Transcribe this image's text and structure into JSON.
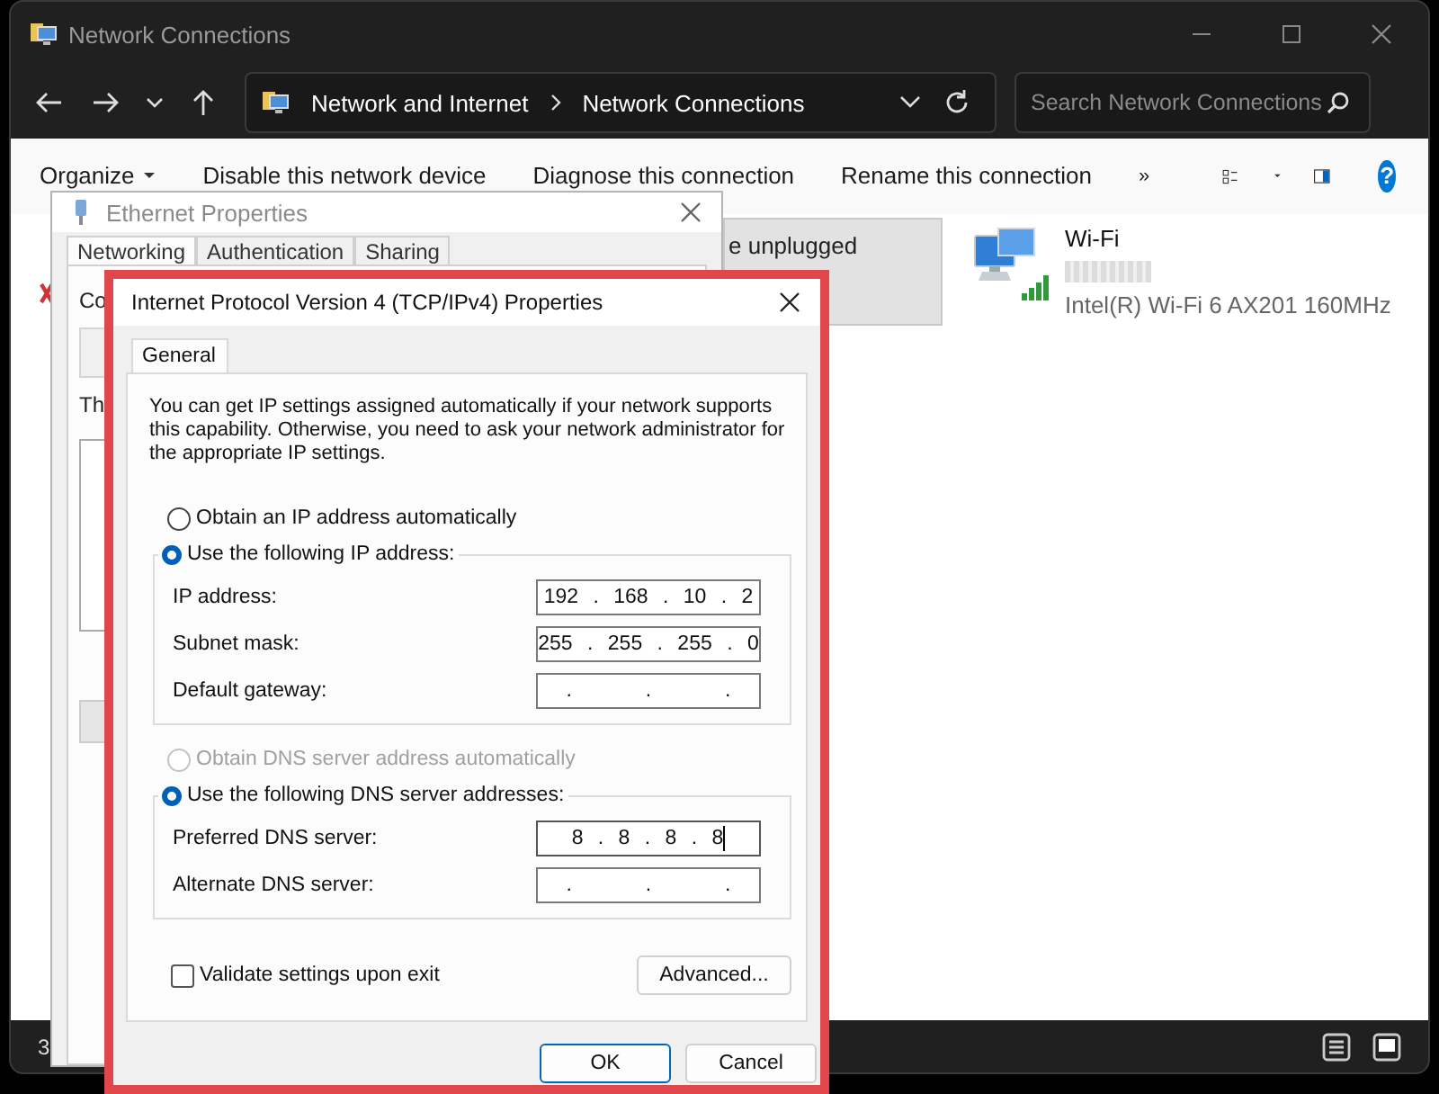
{
  "explorer": {
    "title": "Network Connections",
    "breadcrumb": [
      "Network and Internet",
      "Network Connections"
    ],
    "search": {
      "placeholder": "Search Network Connections"
    },
    "commands": [
      {
        "label": "Organize",
        "kind": "menu"
      },
      {
        "label": "Disable this network device",
        "kind": "action"
      },
      {
        "label": "Diagnose this connection",
        "kind": "action"
      },
      {
        "label": "Rename this connection",
        "kind": "action"
      }
    ],
    "overflow": "»",
    "help": "?",
    "connections": [
      {
        "kind": "partial",
        "status": "e unplugged",
        "selected": true
      },
      {
        "kind": "wifi",
        "name": "Wi-Fi",
        "adapter": "Intel(R) Wi-Fi 6 AX201 160MHz",
        "selected": false
      }
    ],
    "status_bar": {
      "item_count": "3"
    }
  },
  "ethernet_properties": {
    "title": "Ethernet Properties",
    "tabs": [
      {
        "label": "Networking",
        "selected": true
      },
      {
        "label": "Authentication",
        "selected": false
      },
      {
        "label": "Sharing",
        "selected": false
      }
    ],
    "labels": [
      "Co",
      "Th"
    ]
  },
  "ipv4_dialog": {
    "title": "Internet Protocol Version 4 (TCP/IPv4) Properties",
    "highlighted": true,
    "tabs": [
      {
        "label": "General",
        "selected": true
      }
    ],
    "description": "You can get IP settings assigned automatically if your network supports this capability. Otherwise, you need to ask your network administrator for the appropriate IP settings.",
    "sections": [
      {
        "auto_option": {
          "label": "Obtain an IP address automatically",
          "selected": false,
          "disabled": false
        },
        "manual_option": {
          "label": "Use the following IP address:",
          "selected": true,
          "disabled": false
        },
        "fields": [
          {
            "label": "IP address:",
            "value": "192 . 168 . 10 . 2",
            "focused": false
          },
          {
            "label": "Subnet mask:",
            "value": "255 . 255 . 255 . 0",
            "focused": false
          },
          {
            "label": "Default gateway:",
            "value": ".     .     .",
            "focused": false
          }
        ]
      },
      {
        "auto_option": {
          "label": "Obtain DNS server address automatically",
          "selected": false,
          "disabled": true
        },
        "manual_option": {
          "label": "Use the following DNS server addresses:",
          "selected": true,
          "disabled": false
        },
        "fields": [
          {
            "label": "Preferred DNS server:",
            "value": "8 . 8 . 8 . 8",
            "focused": true
          },
          {
            "label": "Alternate DNS server:",
            "value": ".     .     .",
            "focused": false
          }
        ]
      }
    ],
    "validate": {
      "label": "Validate settings upon exit",
      "checked": false
    },
    "advanced_button": "Advanced...",
    "buttons": [
      {
        "label": "OK",
        "default": true
      },
      {
        "label": "Cancel",
        "default": false
      }
    ]
  }
}
